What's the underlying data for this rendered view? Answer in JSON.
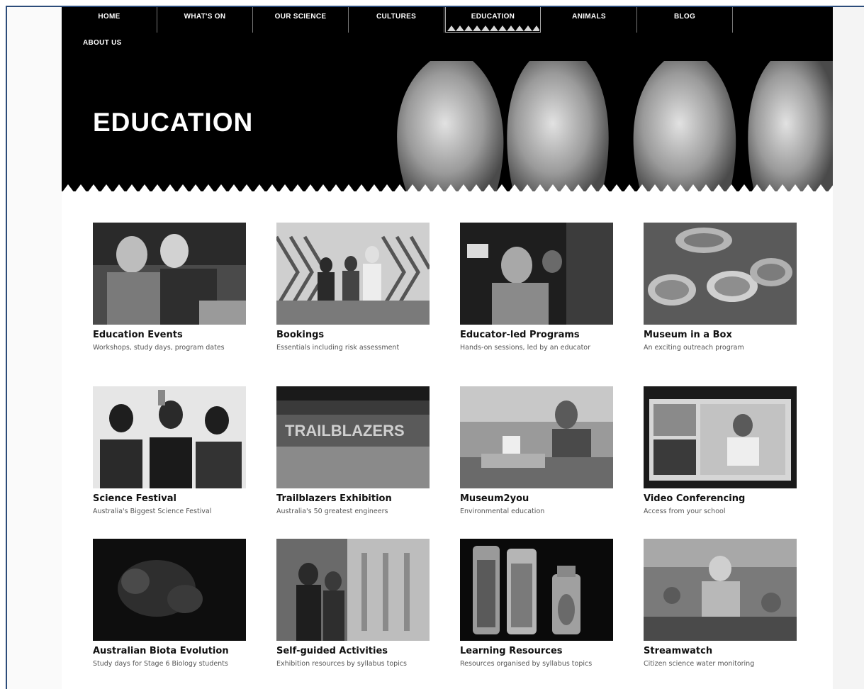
{
  "nav": {
    "items": [
      "HOME",
      "WHAT'S ON",
      "OUR SCIENCE",
      "CULTURES",
      "EDUCATION",
      "ANIMALS",
      "BLOG"
    ],
    "active": "EDUCATION",
    "about": "ABOUT US"
  },
  "hero": {
    "title": "EDUCATION"
  },
  "cards": [
    {
      "title": "Education Events",
      "desc": "Workshops, study days, program dates"
    },
    {
      "title": "Bookings",
      "desc": "Essentials including risk assessment"
    },
    {
      "title": "Educator-led Programs",
      "desc": "Hands-on sessions, led by an educator"
    },
    {
      "title": "Museum in a Box",
      "desc": "An exciting outreach program"
    },
    {
      "title": "Science Festival",
      "desc": "Australia's Biggest Science Festival"
    },
    {
      "title": "Trailblazers Exhibition",
      "desc": "Australia's 50 greatest engineers"
    },
    {
      "title": "Museum2you",
      "desc": "Environmental education"
    },
    {
      "title": "Video Conferencing",
      "desc": "Access from your school"
    },
    {
      "title": "Australian Biota Evolution",
      "desc": "Study days for Stage 6 Biology students"
    },
    {
      "title": "Self-guided Activities",
      "desc": "Exhibition resources by syllabus topics"
    },
    {
      "title": "Learning Resources",
      "desc": "Resources organised by syllabus topics"
    },
    {
      "title": "Streamwatch",
      "desc": "Citizen science water monitoring"
    }
  ],
  "thumb_text": {
    "trailblazers_banner": "TRAILBLAZERS"
  },
  "colors": {
    "header_bg": "#000000",
    "frame_border": "#2c4c7a"
  }
}
